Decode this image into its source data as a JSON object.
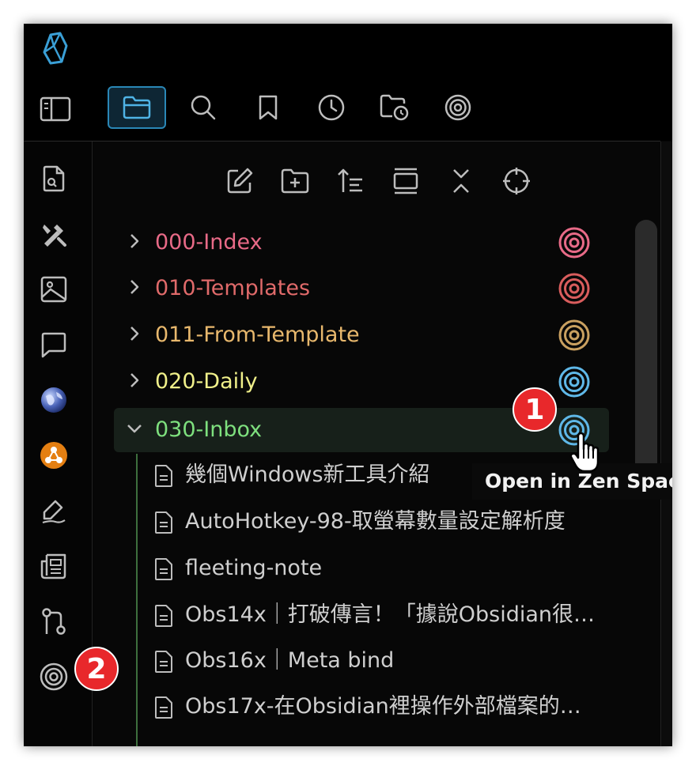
{
  "colors": {
    "accent": "#2a87b6",
    "folder_index": "#e86a87",
    "folder_templates": "#e06a6a",
    "folder_from_template": "#e8b86d",
    "folder_daily": "#f0f08a",
    "folder_inbox": "#7ee07e",
    "badge": "#e8282b"
  },
  "header": {
    "logo": "obsidian-logo",
    "tabs": [
      {
        "icon": "folder-icon",
        "active": true
      },
      {
        "icon": "search-icon",
        "active": false
      },
      {
        "icon": "bookmark-icon",
        "active": false
      },
      {
        "icon": "clock-icon",
        "active": false
      },
      {
        "icon": "folder-clock-icon",
        "active": false
      },
      {
        "icon": "target-icon",
        "active": false
      }
    ]
  },
  "ribbon": {
    "items": [
      "file-search-icon",
      "tools-icon",
      "image-icon",
      "message-icon",
      "globe-icon",
      "network-icon",
      "sign-icon",
      "newspaper-icon",
      "git-icon",
      "target-icon"
    ]
  },
  "explorer_toolbar": [
    "new-note-icon",
    "new-folder-icon",
    "sort-icon",
    "collapse-view-icon",
    "collapse-all-icon",
    "reveal-icon"
  ],
  "folders": [
    {
      "label": "000-Index",
      "expanded": false
    },
    {
      "label": "010-Templates",
      "expanded": false
    },
    {
      "label": "011-From-Template",
      "expanded": false
    },
    {
      "label": "020-Daily",
      "expanded": false
    },
    {
      "label": "030-Inbox",
      "expanded": true
    }
  ],
  "files": [
    {
      "label": "幾個Windows新工具介紹"
    },
    {
      "label": "AutoHotkey-98-取螢幕數量設定解析度"
    },
    {
      "label": "fleeting-note"
    },
    {
      "label": "Obs14x｜打破傳言！「據說Obsidian很…"
    },
    {
      "label": "Obs16x｜Meta bind"
    },
    {
      "label": "Obs17x-在Obsidian裡操作外部檔案的…"
    }
  ],
  "tooltip": "Open in Zen Space",
  "badges": [
    "1",
    "2"
  ]
}
